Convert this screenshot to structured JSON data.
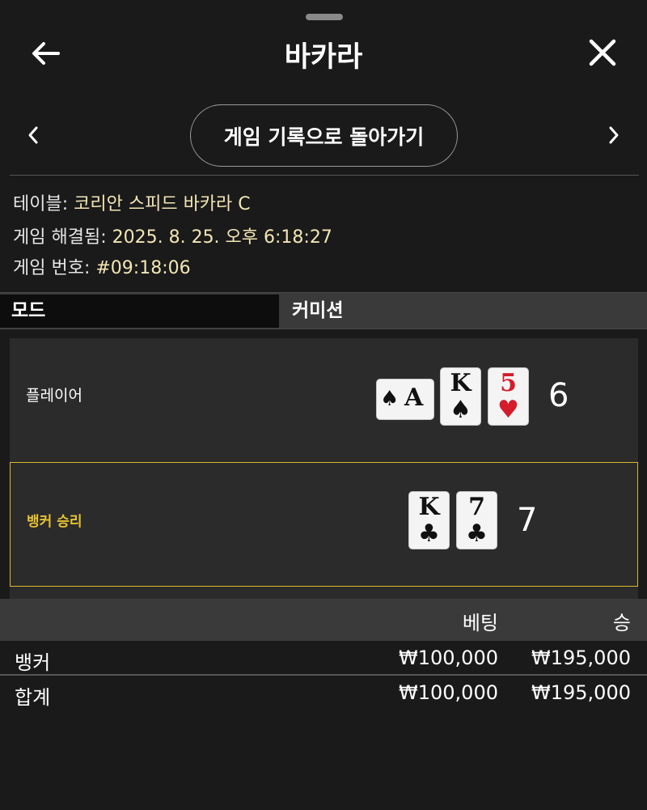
{
  "header": {
    "title": "바카라",
    "back_icon": "arrow-left-icon",
    "close_icon": "close-icon"
  },
  "nav": {
    "back_to_history_label": "게임 기록으로 돌아가기",
    "prev_icon": "chevron-left-icon",
    "next_icon": "chevron-right-icon"
  },
  "info": {
    "table_label": "테이블:",
    "table_value": "코리안 스피드 바카라 C",
    "resolved_label": "게임 해결됨:",
    "resolved_value": "2025. 8. 25. 오후 6:18:27",
    "game_no_label": "게임 번호:",
    "game_no_value": "#09:18:06"
  },
  "mode": {
    "label": "모드",
    "value": "커미션"
  },
  "hands": {
    "player": {
      "label": "플레이어",
      "score": "6",
      "cards": [
        {
          "rank": "A",
          "suit": "♠",
          "color": "#111111",
          "orientation": "sideways"
        },
        {
          "rank": "K",
          "suit": "♠",
          "color": "#111111",
          "orientation": "upright"
        },
        {
          "rank": "5",
          "suit": "♥",
          "color": "#d41c2a",
          "orientation": "upright"
        }
      ]
    },
    "banker": {
      "label": "뱅커 승리",
      "score": "7",
      "highlight_color": "#d9b92b",
      "cards": [
        {
          "rank": "K",
          "suit": "♣",
          "color": "#111111",
          "orientation": "upright"
        },
        {
          "rank": "7",
          "suit": "♣",
          "color": "#111111",
          "orientation": "upright"
        }
      ]
    }
  },
  "bets": {
    "columns": {
      "bet": "베팅",
      "win": "승"
    },
    "rows": [
      {
        "label": "뱅커",
        "bet": "₩100,000",
        "win": "₩195,000"
      }
    ],
    "total": {
      "label": "합계",
      "bet": "₩100,000",
      "win": "₩195,000"
    }
  }
}
